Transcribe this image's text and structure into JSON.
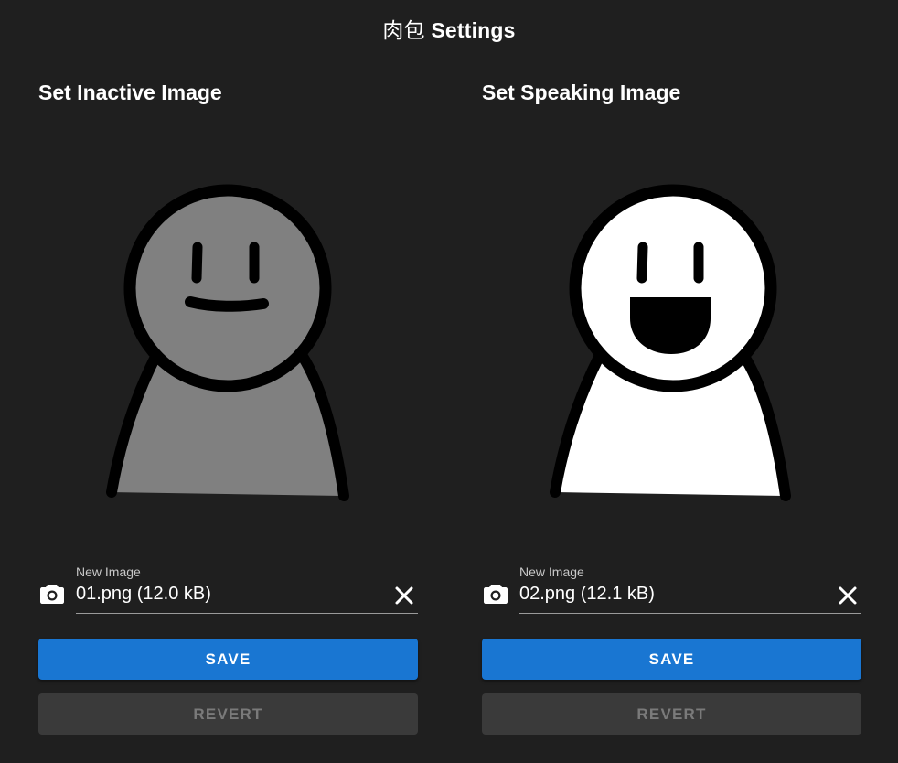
{
  "header": {
    "title_cjk": "肉包",
    "title_text": "Settings"
  },
  "panels": [
    {
      "title": "Set Inactive Image",
      "avatar": {
        "state": "inactive",
        "fill_color": "#808080",
        "expression": "smile"
      },
      "file_input": {
        "label": "New Image",
        "value": "01.png (12.0 kB)",
        "prefix_icon": "camera-icon",
        "clear_icon": "close-icon"
      },
      "save_label": "SAVE",
      "revert_label": "REVERT"
    },
    {
      "title": "Set Speaking Image",
      "avatar": {
        "state": "speaking",
        "fill_color": "#ffffff",
        "expression": "open-mouth"
      },
      "file_input": {
        "label": "New Image",
        "value": "02.png (12.1 kB)",
        "prefix_icon": "camera-icon",
        "clear_icon": "close-icon"
      },
      "save_label": "SAVE",
      "revert_label": "REVERT"
    }
  ],
  "colors": {
    "background": "#1f1f1f",
    "primary_button": "#1976d2",
    "disabled_button": "#3a3a3a",
    "disabled_text": "#7a7a7a"
  }
}
